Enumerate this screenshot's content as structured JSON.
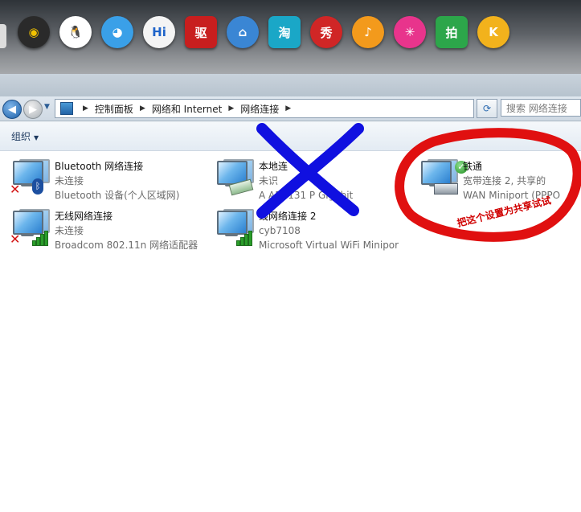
{
  "dock": {
    "icons": [
      {
        "name": "webcam-app-icon",
        "glyph": "◉",
        "color": "#2a2a2a",
        "fg": "#f2c200"
      },
      {
        "name": "qq-penguin-icon",
        "glyph": "🐧",
        "color": "#ffffff",
        "fg": "#111"
      },
      {
        "name": "chat-bubble-icon",
        "glyph": "◕",
        "color": "#3aa0e8",
        "fg": "#fff"
      },
      {
        "name": "hi-messenger-icon",
        "glyph": "Hi",
        "color": "#f4f4f4",
        "fg": "#1e63c9"
      },
      {
        "name": "driver-app-icon",
        "glyph": "驱",
        "color": "#c81e1e",
        "fg": "#fff"
      },
      {
        "name": "home-app-icon",
        "glyph": "⌂",
        "color": "#3a86d4",
        "fg": "#fff"
      },
      {
        "name": "taobao-icon",
        "glyph": "淘",
        "color": "#1aa7c7",
        "fg": "#fff"
      },
      {
        "name": "xiu-app-icon",
        "glyph": "秀",
        "color": "#d02626",
        "fg": "#fff"
      },
      {
        "name": "music-app-icon",
        "glyph": "♪",
        "color": "#f39a1c",
        "fg": "#fff"
      },
      {
        "name": "star-app-icon",
        "glyph": "✳",
        "color": "#e8348c",
        "fg": "#fff"
      },
      {
        "name": "paipai-icon",
        "glyph": "拍",
        "color": "#2ca64a",
        "fg": "#fff"
      },
      {
        "name": "k-app-icon",
        "glyph": "K",
        "color": "#f2b21c",
        "fg": "#fff"
      }
    ]
  },
  "address": {
    "crumbs": [
      "控制面板",
      "网络和 Internet",
      "网络连接"
    ],
    "search_placeholder": "搜索 网络连接"
  },
  "toolbar": {
    "organize_label": "组织"
  },
  "connections": [
    {
      "name": "Bluetooth 网络连接",
      "status": "未连接",
      "device": "Bluetooth 设备(个人区域网)"
    },
    {
      "name": "本地连",
      "status": "未识",
      "device": "A AR8131 P Gigabit"
    },
    {
      "name": "铁通",
      "status": "宽带连接 2, 共享的",
      "device": "WAN Miniport (PPPO"
    },
    {
      "name": "无线网络连接",
      "status": "未连接",
      "device": "Broadcom 802.11n 网络适配器"
    },
    {
      "name": "线网络连接 2",
      "status": "cyb7108",
      "device": "Microsoft Virtual WiFi Minipor"
    }
  ],
  "annotations": {
    "handwritten_note": "把这个设置为共享试试",
    "red_color": "#e01010",
    "blue_color": "#1010e0"
  }
}
